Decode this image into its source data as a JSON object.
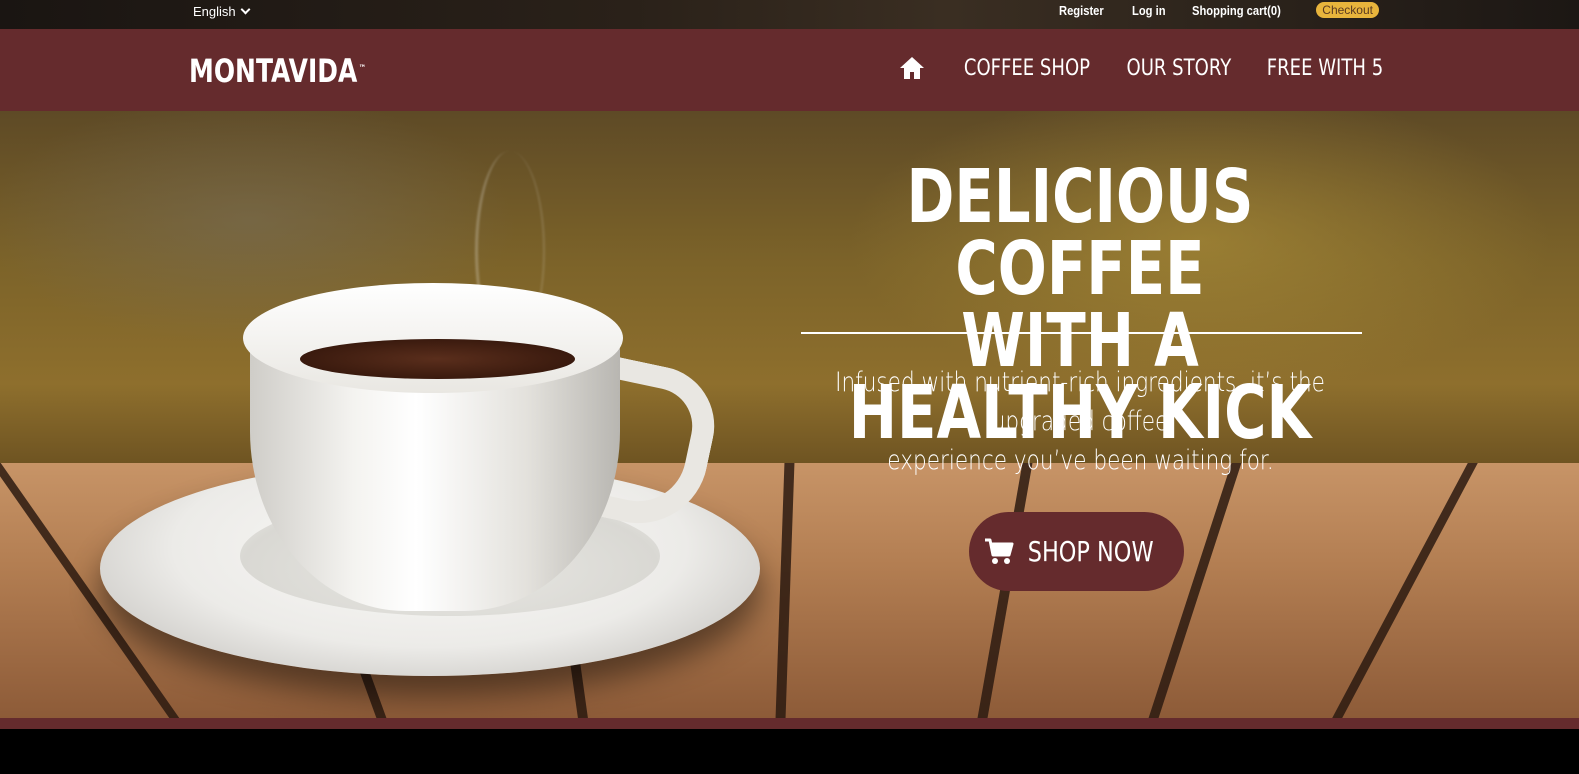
{
  "topbar": {
    "language": "English",
    "links": [
      "Register",
      "Log in",
      "Shopping cart(0)"
    ],
    "checkout": "Checkout"
  },
  "navbar": {
    "logo": "MONTAVIDA",
    "logo_mark": "™",
    "items": [
      "COFFEE SHOP",
      "OUR STORY",
      "FREE WITH 5"
    ]
  },
  "hero": {
    "headline_line1": "DELICIOUS COFFEE",
    "headline_line2": "WITH A HEALTHY KICK",
    "subtext_line1": "Infused with nutrient-rich ingredients, it’s the upgraded coffee",
    "subtext_line2": "experience you’ve been waiting for.",
    "cta": "SHOP NOW"
  },
  "colors": {
    "brand": "#652b2d",
    "checkout": "#e8b43c"
  }
}
